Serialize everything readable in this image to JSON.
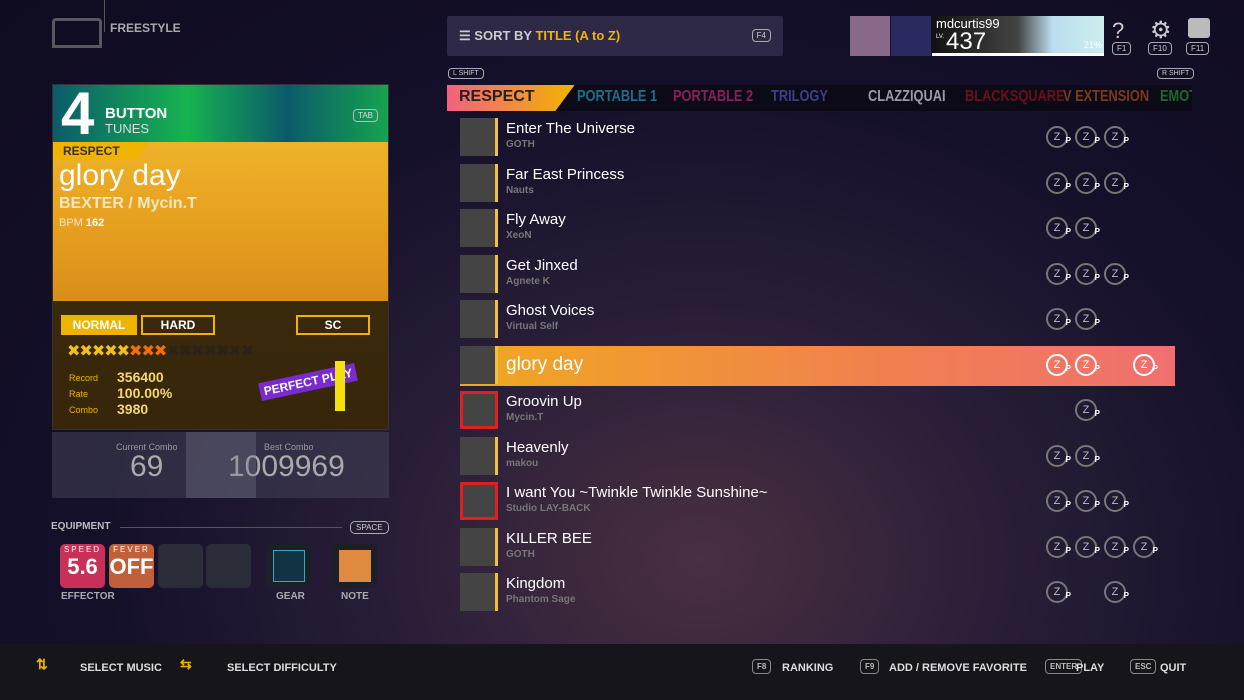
{
  "header": {
    "mode": "FREESTYLE",
    "sort_label": "SORT BY",
    "sort_value": "TITLE (A to Z)",
    "sort_key": "F4",
    "profile": {
      "username": "mdcurtis99",
      "level_label": "LV.",
      "level": "437",
      "progress": "21%"
    },
    "icons": [
      {
        "name": "help-icon",
        "key": "F1"
      },
      {
        "name": "gear-icon",
        "key": "F10"
      },
      {
        "name": "box-icon",
        "key": "F11"
      }
    ]
  },
  "category_keys": {
    "left": "L SHIFT",
    "right": "R SHIFT"
  },
  "categories": [
    {
      "label": "RESPECT",
      "color": "#222222"
    },
    {
      "label": "PORTABLE 1",
      "color": "#1a6f8a"
    },
    {
      "label": "PORTABLE 2",
      "color": "#8a1f5a"
    },
    {
      "label": "TRILOGY",
      "color": "#3a3f8a"
    },
    {
      "label": "CLAZZIQUAI",
      "color": "#9a9aa8"
    },
    {
      "label": "BLACKSQUARE",
      "color": "#6a1018"
    },
    {
      "label": "V EXTENSION",
      "color": "#7a3a1a"
    },
    {
      "label": "EMOT",
      "color": "#1a6a2a"
    }
  ],
  "selected": {
    "button_count": "4",
    "button_label": "BUTTON",
    "tunes_label": "TUNES",
    "tab_key": "TAB",
    "category": "RESPECT",
    "title": "glory day",
    "artist": "BEXTER / Mycin.T",
    "bpm_label": "BPM",
    "bpm": "162",
    "difficulties": [
      "NORMAL",
      "HARD",
      "SC"
    ],
    "active_difficulty": "NORMAL",
    "stars_lit": 8,
    "stars_total": 15,
    "record_label": "Record",
    "record": "356400",
    "rate_label": "Rate",
    "rate": "100.00%",
    "combo_label": "Combo",
    "combo": "3980",
    "badge": "PERFECT PLAY",
    "current_combo_label": "Current Combo",
    "current_combo": "69",
    "best_combo_label": "Best Combo",
    "best_combo": "1009969"
  },
  "equipment": {
    "label": "EQUIPMENT",
    "key": "SPACE",
    "speed_label": "SPEED",
    "speed": "5.6",
    "fever_label": "FEVER",
    "fever": "OFF",
    "effector_label": "EFFECTOR",
    "gear_label": "GEAR",
    "note_label": "NOTE"
  },
  "songs": [
    {
      "title": "Enter The Universe",
      "artist": "GOTH",
      "medals": [
        1,
        2,
        3
      ]
    },
    {
      "title": "Far East Princess",
      "artist": "Nauts",
      "medals": [
        1,
        2,
        3
      ]
    },
    {
      "title": "Fly Away",
      "artist": "XeoN",
      "medals": [
        1,
        2
      ]
    },
    {
      "title": "Get Jinxed",
      "artist": "Agnete K",
      "medals": [
        1,
        2,
        3
      ]
    },
    {
      "title": "Ghost Voices",
      "artist": "Virtual Self",
      "medals": [
        1,
        2
      ]
    },
    {
      "title": "glory day",
      "artist": "",
      "medals": [
        1,
        2,
        4
      ],
      "selected": true
    },
    {
      "title": "Groovin Up",
      "artist": "Mycin.T",
      "medals": [
        2
      ],
      "highlighted": true
    },
    {
      "title": "Heavenly",
      "artist": "makou",
      "medals": [
        1,
        2
      ]
    },
    {
      "title": "I want You ~Twinkle Twinkle Sunshine~",
      "artist": "Studio LAY-BACK",
      "medals": [
        1,
        2,
        3
      ],
      "highlighted": true
    },
    {
      "title": "KILLER BEE",
      "artist": "GOTH",
      "medals": [
        1,
        2,
        3,
        4
      ]
    },
    {
      "title": "Kingdom",
      "artist": "Phantom Sage",
      "medals": [
        1,
        3
      ]
    }
  ],
  "footer": {
    "select_music": "SELECT MUSIC",
    "select_difficulty": "SELECT DIFFICULTY",
    "ranking_key": "F8",
    "ranking": "RANKING",
    "fav_key": "F9",
    "fav": "ADD / REMOVE FAVORITE",
    "play_key": "ENTER",
    "play": "PLAY",
    "quit_key": "ESC",
    "quit": "QUIT"
  }
}
